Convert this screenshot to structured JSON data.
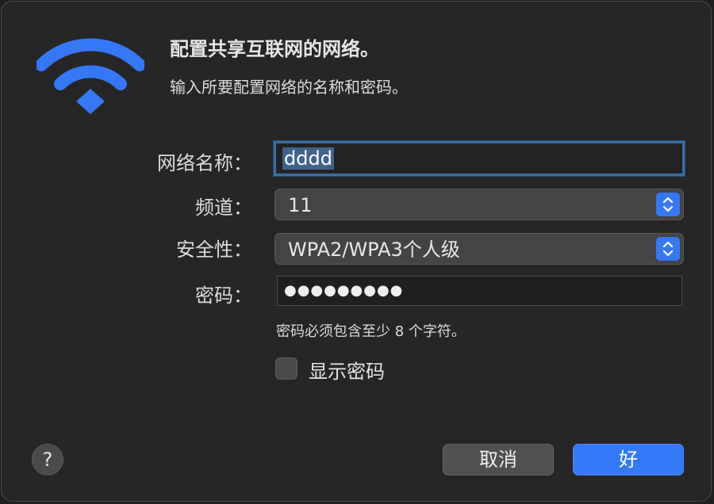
{
  "dialog": {
    "title": "配置共享互联网的网络。",
    "subtitle": "输入所要配置网络的名称和密码。"
  },
  "form": {
    "network_name_label": "网络名称：",
    "network_name_value": "dddd",
    "channel_label": "频道：",
    "channel_value": "11",
    "security_label": "安全性：",
    "security_value": "WPA2/WPA3个人级",
    "password_label": "密码：",
    "password_masked": "●●●●●●●●●",
    "password_hint": "密码必须包含至少 8 个字符。",
    "show_password_label": "显示密码",
    "show_password_checked": false
  },
  "buttons": {
    "help": "?",
    "cancel": "取消",
    "ok": "好"
  },
  "icons": {
    "wifi": "wifi-icon",
    "stepper": "chevron-up-down-icon"
  },
  "colors": {
    "accent": "#3478f6",
    "background": "#262626",
    "text": "#e6e6e6"
  }
}
